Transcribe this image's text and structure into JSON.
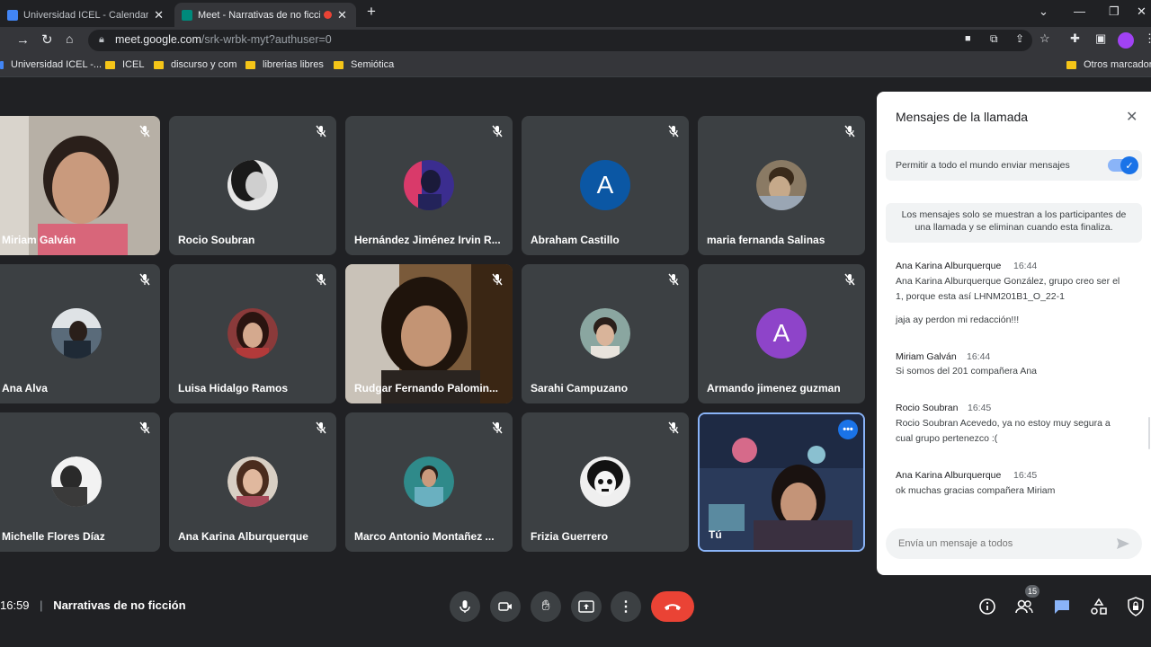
{
  "browser": {
    "tabs": [
      {
        "title": "Universidad ICEL - Calendar - m",
        "favicon_color": "#4285f4"
      },
      {
        "title": "Meet - Narrativas de no ficci",
        "favicon_color": "#00897b"
      }
    ],
    "url_host": "meet.google.com",
    "url_path": "/srk-wrbk-myt?authuser=0",
    "bookmarks": [
      "Universidad ICEL -...",
      "ICEL",
      "discurso y com",
      "librerias libres",
      "Semiótica"
    ],
    "other_bookmarks": "Otros marcadores"
  },
  "participants": [
    {
      "name": "Miriam Galván",
      "tile": "video"
    },
    {
      "name": "Rocio Soubran",
      "tile": "avatar",
      "bg": "#d0d0d0"
    },
    {
      "name": "Hernández Jiménez Irvin R...",
      "tile": "avatar",
      "bg": "#3b2d8f"
    },
    {
      "name": "Abraham Castillo",
      "tile": "letter",
      "letter": "A",
      "bg": "#0b57a4"
    },
    {
      "name": "maria fernanda Salinas",
      "tile": "avatar",
      "bg": "#8a7a64"
    },
    {
      "name": "Ana Alva",
      "tile": "avatar",
      "bg": "#5a6b7a"
    },
    {
      "name": "Luisa Hidalgo Ramos",
      "tile": "avatar",
      "bg": "#8a3a3a"
    },
    {
      "name": "Rudgar Fernando Palomin...",
      "tile": "video"
    },
    {
      "name": "Sarahi Campuzano",
      "tile": "avatar",
      "bg": "#8aa6a0"
    },
    {
      "name": "Armando jimenez guzman",
      "tile": "letter",
      "letter": "A",
      "bg": "#8e44c9"
    },
    {
      "name": "Michelle Flores Díaz",
      "tile": "avatar",
      "bg": "#707070"
    },
    {
      "name": "Ana Karina Alburquerque",
      "tile": "avatar",
      "bg": "#9a7a6a"
    },
    {
      "name": "Marco Antonio Montañez ...",
      "tile": "avatar",
      "bg": "#2f8a8a"
    },
    {
      "name": "Frizia Guerrero",
      "tile": "avatar",
      "bg": "#efefef"
    },
    {
      "name": "Tú",
      "tile": "self"
    }
  ],
  "meeting": {
    "time": "16:59",
    "title": "Narrativas de no ficción",
    "participant_count": "15"
  },
  "chat": {
    "title": "Mensajes de la llamada",
    "toggle_label": "Permitir a todo el mundo enviar mensajes",
    "toggle_on": true,
    "notice": "Los mensajes solo se muestran a los participantes de una llamada y se eliminan cuando esta finaliza.",
    "messages": [
      {
        "sender": "Ana Karina Alburquerque",
        "time": "16:44",
        "lines": [
          "Ana Karina Alburquerque González, grupo creo ser el",
          "1, porque esta así  LHNM201B1_O_22-1",
          "jaja ay perdon mi redacción!!!"
        ]
      },
      {
        "sender": "Miriam Galván",
        "time": "16:44",
        "lines": [
          "Si somos del 201 compañera  Ana"
        ]
      },
      {
        "sender": "Rocio Soubran",
        "time": "16:45",
        "lines": [
          "Rocio Soubran Acevedo, ya no estoy muy segura a",
          "cual grupo pertenezco :("
        ]
      },
      {
        "sender": "Ana Karina Alburquerque",
        "time": "16:45",
        "lines": [
          "ok muchas gracias compañera Miriam"
        ]
      }
    ],
    "input_placeholder": "Envía un mensaje a todos"
  },
  "colors": {
    "accent": "#1a73e8",
    "end_call": "#ea4335",
    "tile_bg": "#3c4043",
    "page_bg": "#202124"
  }
}
